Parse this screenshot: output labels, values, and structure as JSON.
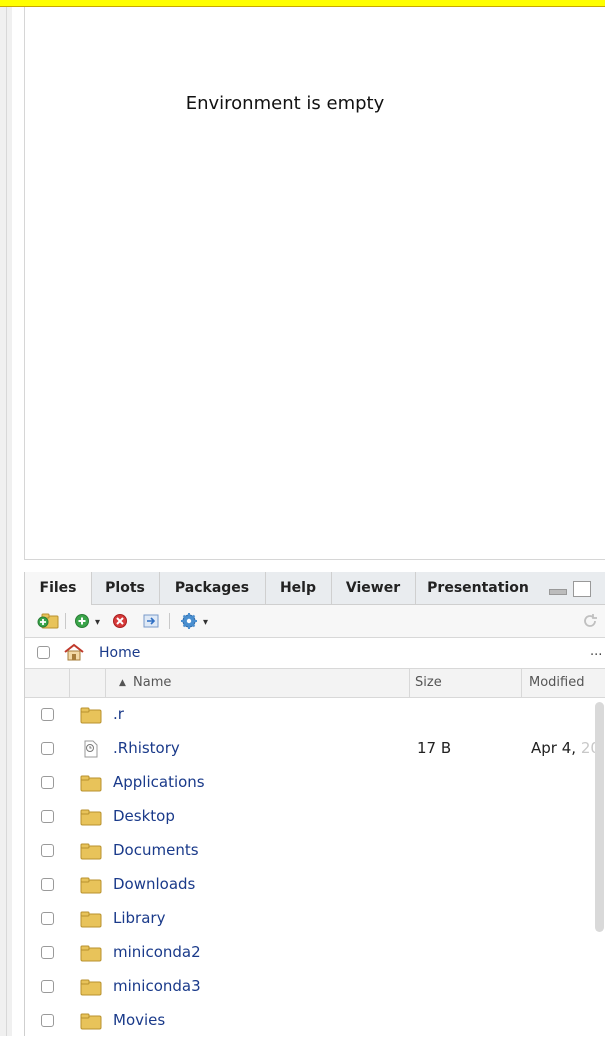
{
  "environment": {
    "empty_message": "Environment is empty"
  },
  "files_pane": {
    "tabs": [
      {
        "label": "Files",
        "active": true
      },
      {
        "label": "Plots",
        "active": false
      },
      {
        "label": "Packages",
        "active": false
      },
      {
        "label": "Help",
        "active": false
      },
      {
        "label": "Viewer",
        "active": false
      },
      {
        "label": "Presentation",
        "active": false
      }
    ],
    "toolbar_icons": [
      "new-folder-icon",
      "add-blank-file-icon",
      "dropdown-caret-icon",
      "delete-icon",
      "rename-icon",
      "more-gear-icon",
      "dropdown-caret-icon",
      "refresh-icon"
    ],
    "path": {
      "label": "Home",
      "more": "..."
    },
    "columns": {
      "name": "Name",
      "size": "Size",
      "modified": "Modified"
    },
    "rows": [
      {
        "name": ".r",
        "type": "folder",
        "size": "",
        "modified": ""
      },
      {
        "name": ".Rhistory",
        "type": "file",
        "size": "17 B",
        "modified": "Apr 4, ",
        "modified_cut": "20"
      },
      {
        "name": "Applications",
        "type": "folder",
        "size": "",
        "modified": ""
      },
      {
        "name": "Desktop",
        "type": "folder",
        "size": "",
        "modified": ""
      },
      {
        "name": "Documents",
        "type": "folder",
        "size": "",
        "modified": ""
      },
      {
        "name": "Downloads",
        "type": "folder",
        "size": "",
        "modified": ""
      },
      {
        "name": "Library",
        "type": "folder",
        "size": "",
        "modified": ""
      },
      {
        "name": "miniconda2",
        "type": "folder",
        "size": "",
        "modified": ""
      },
      {
        "name": "miniconda3",
        "type": "folder",
        "size": "",
        "modified": ""
      },
      {
        "name": "Movies",
        "type": "folder",
        "size": "",
        "modified": ""
      }
    ]
  },
  "colors": {
    "link": "#1a3a8a",
    "folder": "#e8c35a",
    "highlight": "#ffff00"
  }
}
